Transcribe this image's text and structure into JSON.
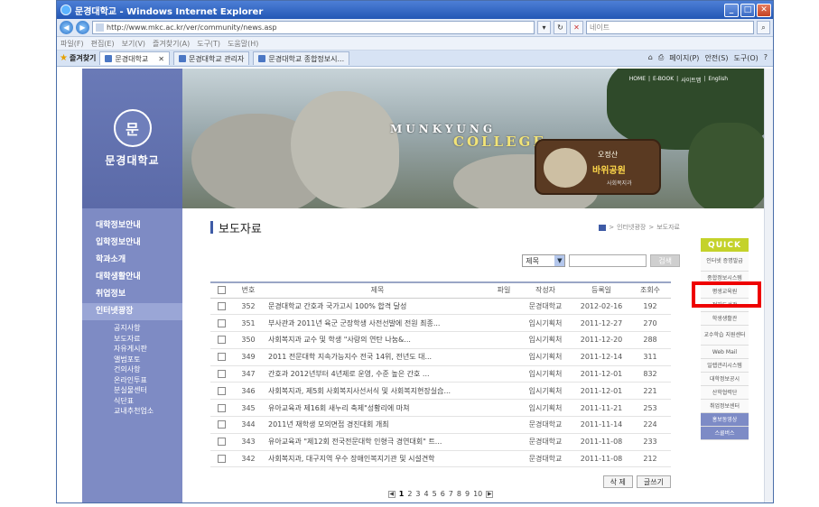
{
  "window": {
    "title": "문경대학교 - Windows Internet Explorer",
    "url": "http://www.mkc.ac.kr/ver/community/news.asp",
    "search_placeholder": "네이트"
  },
  "menubar": [
    "파일(F)",
    "편집(E)",
    "보기(V)",
    "즐겨찾기(A)",
    "도구(T)",
    "도움말(H)"
  ],
  "tabs": {
    "favorites_label": "즐겨찾기",
    "items": [
      "문경대학교",
      "문경대학교 관리자",
      "문경대학교 종합정보시..."
    ],
    "commands": [
      "페이지(P)",
      "안전(S)",
      "도구(O)"
    ]
  },
  "banner": {
    "top_links": [
      "HOME",
      "E-BOOK",
      "사이트맵",
      "English"
    ],
    "college_en": "MUNKYUNG",
    "college_en2": "COLLEGE",
    "park_l1": "오정산",
    "park_l2": "바위공원",
    "park_l3": "사회복지과"
  },
  "logo": {
    "name": "문경대학교",
    "emblem_text": "문"
  },
  "mainnav": [
    "대학정보안내",
    "입학정보안내",
    "학과소개",
    "대학생활안내",
    "취업정보",
    "인터넷광장"
  ],
  "subnav": [
    "공지사항",
    "보도자료",
    "자유게시판",
    "앨범포토",
    "건의사항",
    "온라인투표",
    "분실물센터",
    "식단표",
    "교내추천업소"
  ],
  "content": {
    "title": "보도자료",
    "breadcrumb": [
      "인터넷광장",
      "보도자료"
    ],
    "search_select": "제목",
    "search_button": "검색",
    "columns": [
      "번호",
      "제목",
      "파일",
      "작성자",
      "등록일",
      "조회수"
    ],
    "rows": [
      {
        "no": "352",
        "title": "문경대학교 간호과 국가고시 100% 합격 달성",
        "author": "문경대학교",
        "date": "2012-02-16",
        "views": "192"
      },
      {
        "no": "351",
        "title": "부사관과 2011년 육군 군장학생 사전선발에 전원 최종...",
        "author": "입시기획처",
        "date": "2011-12-27",
        "views": "270"
      },
      {
        "no": "350",
        "title": "사회복지과 교수 및 학생 \"사랑의 연탄 나눔&...",
        "author": "입시기획처",
        "date": "2011-12-20",
        "views": "288"
      },
      {
        "no": "349",
        "title": "2011 전문대학 지속가능지수 전국 14위, 전년도 대...",
        "author": "입시기획처",
        "date": "2011-12-14",
        "views": "311"
      },
      {
        "no": "347",
        "title": "간호과 2012년부터 4년제로 운영, 수준 높은 간호 ...",
        "author": "입시기획처",
        "date": "2011-12-01",
        "views": "832"
      },
      {
        "no": "346",
        "title": "사회복지과, 제5회 사회복지사선서식 및 사회복지현장실습...",
        "author": "입시기획처",
        "date": "2011-12-01",
        "views": "221"
      },
      {
        "no": "345",
        "title": "유아교육과 제16회 새누리 축제\"성황리에 마쳐",
        "author": "입시기획처",
        "date": "2011-11-21",
        "views": "253"
      },
      {
        "no": "344",
        "title": "2011년 재학생 모의면접 경진대회 개최",
        "author": "문경대학교",
        "date": "2011-11-14",
        "views": "224"
      },
      {
        "no": "343",
        "title": "유아교육과 \"제12회 전국전문대학 인형극 경연대회\" 트...",
        "author": "문경대학교",
        "date": "2011-11-08",
        "views": "233"
      },
      {
        "no": "342",
        "title": "사회복지과, 대구지역 우수 장애인복지기관 및 시설견학",
        "author": "문경대학교",
        "date": "2011-11-08",
        "views": "212"
      }
    ],
    "delete_button": "삭 제",
    "write_button": "글쓰기",
    "pages": [
      "1",
      "2",
      "3",
      "4",
      "5",
      "6",
      "7",
      "8",
      "9",
      "10"
    ]
  },
  "quick": {
    "title": "QUICK",
    "items": [
      "인터넷 증명발급",
      "종합정보시스템",
      "평생교육원",
      "전자도서관",
      "학생생활관",
      "교수학습 지원센터",
      "Web Mail",
      "일렙관리시스템",
      "대학정보공시",
      "산학협력단",
      "취업정보센터",
      "홍보동영상",
      "스쿨버스"
    ]
  }
}
